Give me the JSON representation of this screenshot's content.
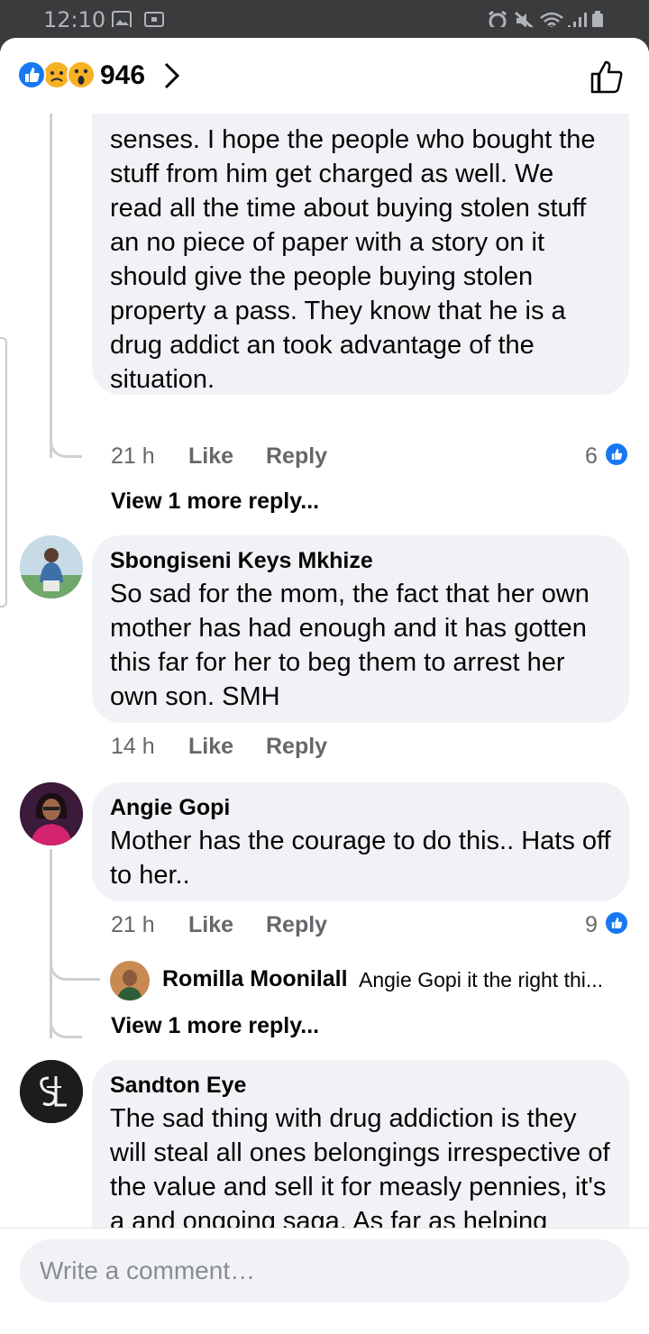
{
  "status_bar": {
    "time": "12:10"
  },
  "header": {
    "reaction_count": "946"
  },
  "comments": [
    {
      "text": "senses. I hope the people who bought the stuff from him get charged as well. We read all the time about buying stolen stuff an no piece of paper with a story on it should give the people buying stolen property a pass. They know that he is a drug addict an took advantage of the situation.",
      "time": "21 h",
      "like": "Like",
      "reply": "Reply",
      "likes": "6",
      "view_more": "View 1 more reply..."
    },
    {
      "author": "Sbongiseni Keys Mkhize",
      "text": "So sad for the mom, the fact that her own mother has had enough and it has gotten this far for her to beg them to arrest her own son. SMH",
      "time": "14 h",
      "like": "Like",
      "reply": "Reply"
    },
    {
      "author": "Angie Gopi",
      "text": "Mother has the courage to do this.. Hats off to her..",
      "time": "21 h",
      "like": "Like",
      "reply": "Reply",
      "likes": "9",
      "reply_preview": {
        "author": "Romilla Moonilall",
        "text": "Angie Gopi it the right thi..."
      },
      "view_more": "View 1 more reply..."
    },
    {
      "author": "Sandton Eye",
      "text": "The sad thing with drug addiction is they will steal all ones belongings irrespective of the value and sell it for measly pennies, it's a and ongoing saga. As far as helping them, money counts before"
    }
  ],
  "composer": {
    "placeholder": "Write a comment…"
  },
  "colors": {
    "accent": "#1877f2",
    "bubble": "#f0f2f5",
    "meta": "#65676b"
  },
  "icons": [
    "image-icon",
    "screen-icon",
    "alarm-icon",
    "mute-icon",
    "wifi-icon",
    "signal-icon",
    "battery-icon",
    "like-reaction-icon",
    "sad-reaction-icon",
    "wow-reaction-icon",
    "chevron-right-icon",
    "thumbs-up-icon"
  ]
}
